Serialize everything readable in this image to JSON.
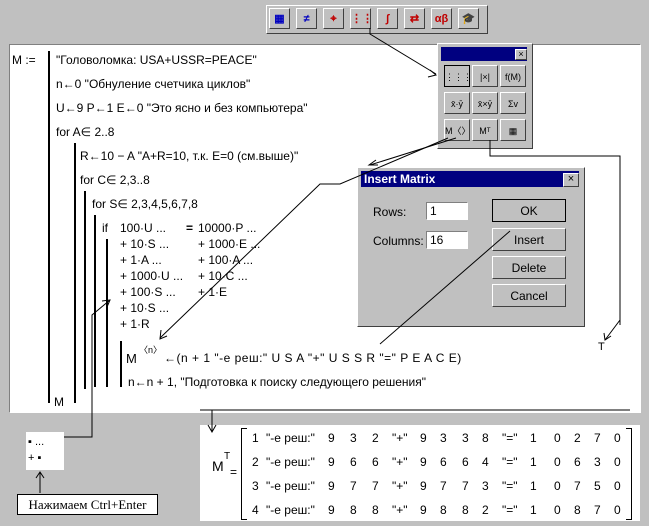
{
  "toolbar": {
    "buttons": [
      {
        "name": "calculator-icon",
        "glyph": "▦",
        "color": "#0000c0"
      },
      {
        "name": "boolean-icon",
        "glyph": "≠",
        "color": "#0000c0"
      },
      {
        "name": "graph-icon",
        "glyph": "⌖",
        "color": "#c00000"
      },
      {
        "name": "matrix-icon",
        "glyph": "⋮⋮",
        "color": "#c00000"
      },
      {
        "name": "calculus-icon",
        "glyph": "∫",
        "color": "#c00000"
      },
      {
        "name": "programming-icon",
        "glyph": "⇄",
        "color": "#c00000"
      },
      {
        "name": "greek-icon",
        "glyph": "αβ",
        "color": "#c00000"
      },
      {
        "name": "symbolic-icon",
        "glyph": "🎓",
        "color": "#000000"
      }
    ]
  },
  "program": {
    "assign": "M :=",
    "line1": "\"Головоломка: USA+USSR=PEACE\"",
    "line2": "n←0  \"Обнуление счетчика циклов\"",
    "line3": "U←9   P←1   E←0  \"Это ясно и без компьютера\"",
    "for_a": "for   A∈ 2..8",
    "line_r": "R←10 − A  \"A+R=10, т.к. E=0 (см.выше)\"",
    "for_c": "for   C∈ 2,3..8",
    "for_s": "for   S∈ 2,3,4,5,6,7,8",
    "if_kw": "if",
    "cond_left": [
      "100·U ...",
      "+ 10·S ...",
      "+ 1·A ...",
      "+ 1000·U ...",
      "+ 100·S ...",
      "+ 10·S ...",
      "+ 1·R"
    ],
    "cond_eq": "=",
    "cond_right": [
      "10000·P ...",
      "+ 1000·E ...",
      "+ 100·A ...",
      "+ 10·C ...",
      "+ 1·E"
    ],
    "assign_m": "M",
    "assign_m_sup": "〈n〉",
    "assign_expr": "←(n + 1   \"-е реш:\"   U   S   A   \"+\"   U   S   S   R   \"=\"   P   E   A   C   E)",
    "assign_t": "T",
    "line_n": "n←n + 1, \"Подготовка к поиску следующего решения\"",
    "return": "M"
  },
  "palette": {
    "close": "×",
    "buttons": [
      "⋮⋮⋮",
      "|×|",
      "f(M)",
      "x̄·ȳ",
      "x̄×ȳ",
      "Σv",
      "M〈〉",
      "Mᵀ",
      "▦"
    ]
  },
  "dialog": {
    "title": "Insert Matrix",
    "rows_label": "Rows:",
    "rows_value": "1",
    "columns_label": "Columns:",
    "columns_value": "16",
    "ok": "OK",
    "insert": "Insert",
    "delete": "Delete",
    "cancel": "Cancel",
    "close": "×"
  },
  "result": {
    "lhs": "M",
    "lhs_sup": "T",
    "eq": "=",
    "rows": [
      [
        "1",
        "\"-е реш:\"",
        "9",
        "3",
        "2",
        "\"+\"",
        "9",
        "3",
        "3",
        "8",
        "\"=\"",
        "1",
        "0",
        "2",
        "7",
        "0"
      ],
      [
        "2",
        "\"-е реш:\"",
        "9",
        "6",
        "6",
        "\"+\"",
        "9",
        "6",
        "6",
        "4",
        "\"=\"",
        "1",
        "0",
        "6",
        "3",
        "0"
      ],
      [
        "3",
        "\"-е реш:\"",
        "9",
        "7",
        "7",
        "\"+\"",
        "9",
        "7",
        "7",
        "3",
        "\"=\"",
        "1",
        "0",
        "7",
        "5",
        "0"
      ],
      [
        "4",
        "\"-е реш:\"",
        "9",
        "8",
        "8",
        "\"+\"",
        "9",
        "8",
        "8",
        "2",
        "\"=\"",
        "1",
        "0",
        "8",
        "7",
        "0"
      ]
    ]
  },
  "placeholder_cell": {
    "top": "▪ ...",
    "bottom": "+ ▪"
  },
  "note": "Нажимаем Ctrl+Enter"
}
